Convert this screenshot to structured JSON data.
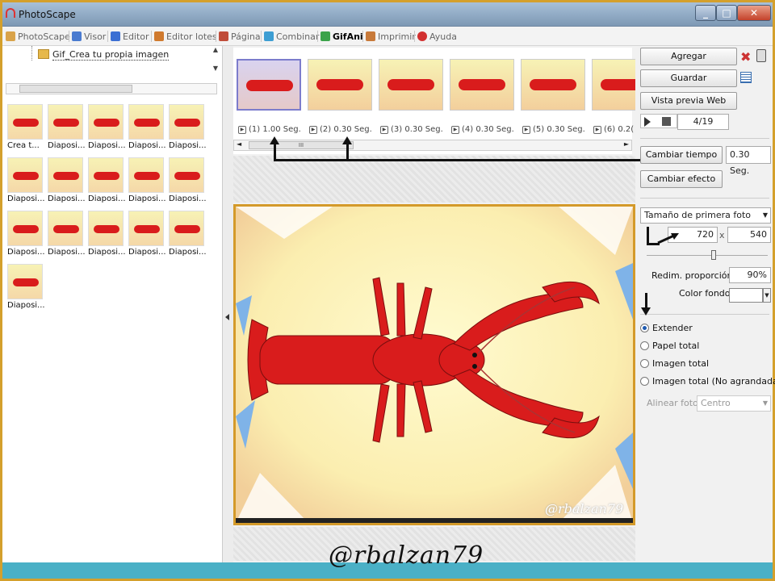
{
  "window": {
    "title": "PhotoScape",
    "min": "_",
    "max": "□",
    "close": "✕"
  },
  "menu": [
    {
      "label": "PhotoScape",
      "icon": "photoscape-icon",
      "color": "#d9a34a"
    },
    {
      "label": "Visor",
      "icon": "viewer-icon",
      "color": "#4a7bd0"
    },
    {
      "label": "Editor",
      "icon": "editor-icon",
      "color": "#3b6fd3"
    },
    {
      "label": "Editor lotes",
      "icon": "batch-editor-icon",
      "color": "#d07a2e"
    },
    {
      "label": "Página",
      "icon": "page-icon",
      "color": "#c04d3a"
    },
    {
      "label": "Combinar",
      "icon": "combine-icon",
      "color": "#3d9ed3"
    },
    {
      "label": "GifAni",
      "icon": "gifani-icon",
      "color": "#3ba34a"
    },
    {
      "label": "Imprimir",
      "icon": "print-icon",
      "color": "#c87a3a"
    },
    {
      "label": "Ayuda",
      "icon": "help-icon",
      "color": "#d23030"
    }
  ],
  "tree": {
    "folder": "Gif_Crea tu propia imagen"
  },
  "thumbs": [
    "Crea t...",
    "Diaposi...",
    "Diaposi...",
    "Diaposi...",
    "Diaposi...",
    "Diaposi...",
    "Diaposi...",
    "Diaposi...",
    "Diaposi...",
    "Diaposi...",
    "Diaposi...",
    "Diaposi...",
    "Diaposi...",
    "Diaposi...",
    "Diaposi...",
    "Diaposi..."
  ],
  "frames": [
    {
      "label": "(1) 1.00 Seg."
    },
    {
      "label": "(2) 0.30 Seg."
    },
    {
      "label": "(3) 0.30 Seg."
    },
    {
      "label": "(4) 0.30 Seg."
    },
    {
      "label": "(5) 0.30 Seg."
    },
    {
      "label": "(6) 0.2("
    }
  ],
  "scroll_grip": "III",
  "right": {
    "agregar": "Agregar",
    "guardar": "Guardar",
    "vista_previa": "Vista previa Web",
    "counter": "4/19",
    "cambiar_tiempo": "Cambiar tiempo",
    "tiempo_value": "0.30 Seg.",
    "cambiar_efecto": "Cambiar efecto",
    "size_mode": "Tamaño de primera foto",
    "width": "720",
    "x": "x",
    "height": "540",
    "redim_label": "Redim. proporción",
    "redim_value": "90%",
    "color_label": "Color fondo",
    "radios": [
      {
        "label": "Extender",
        "checked": true
      },
      {
        "label": "Papel total",
        "checked": false
      },
      {
        "label": "Imagen total",
        "checked": false
      },
      {
        "label": "Imagen total (No agrandada)",
        "checked": false
      }
    ],
    "align_label": "Alinear foto",
    "align_value": "Centro"
  },
  "watermark_small": "@rbalzan79",
  "watermark_big": "@rbalzan79"
}
